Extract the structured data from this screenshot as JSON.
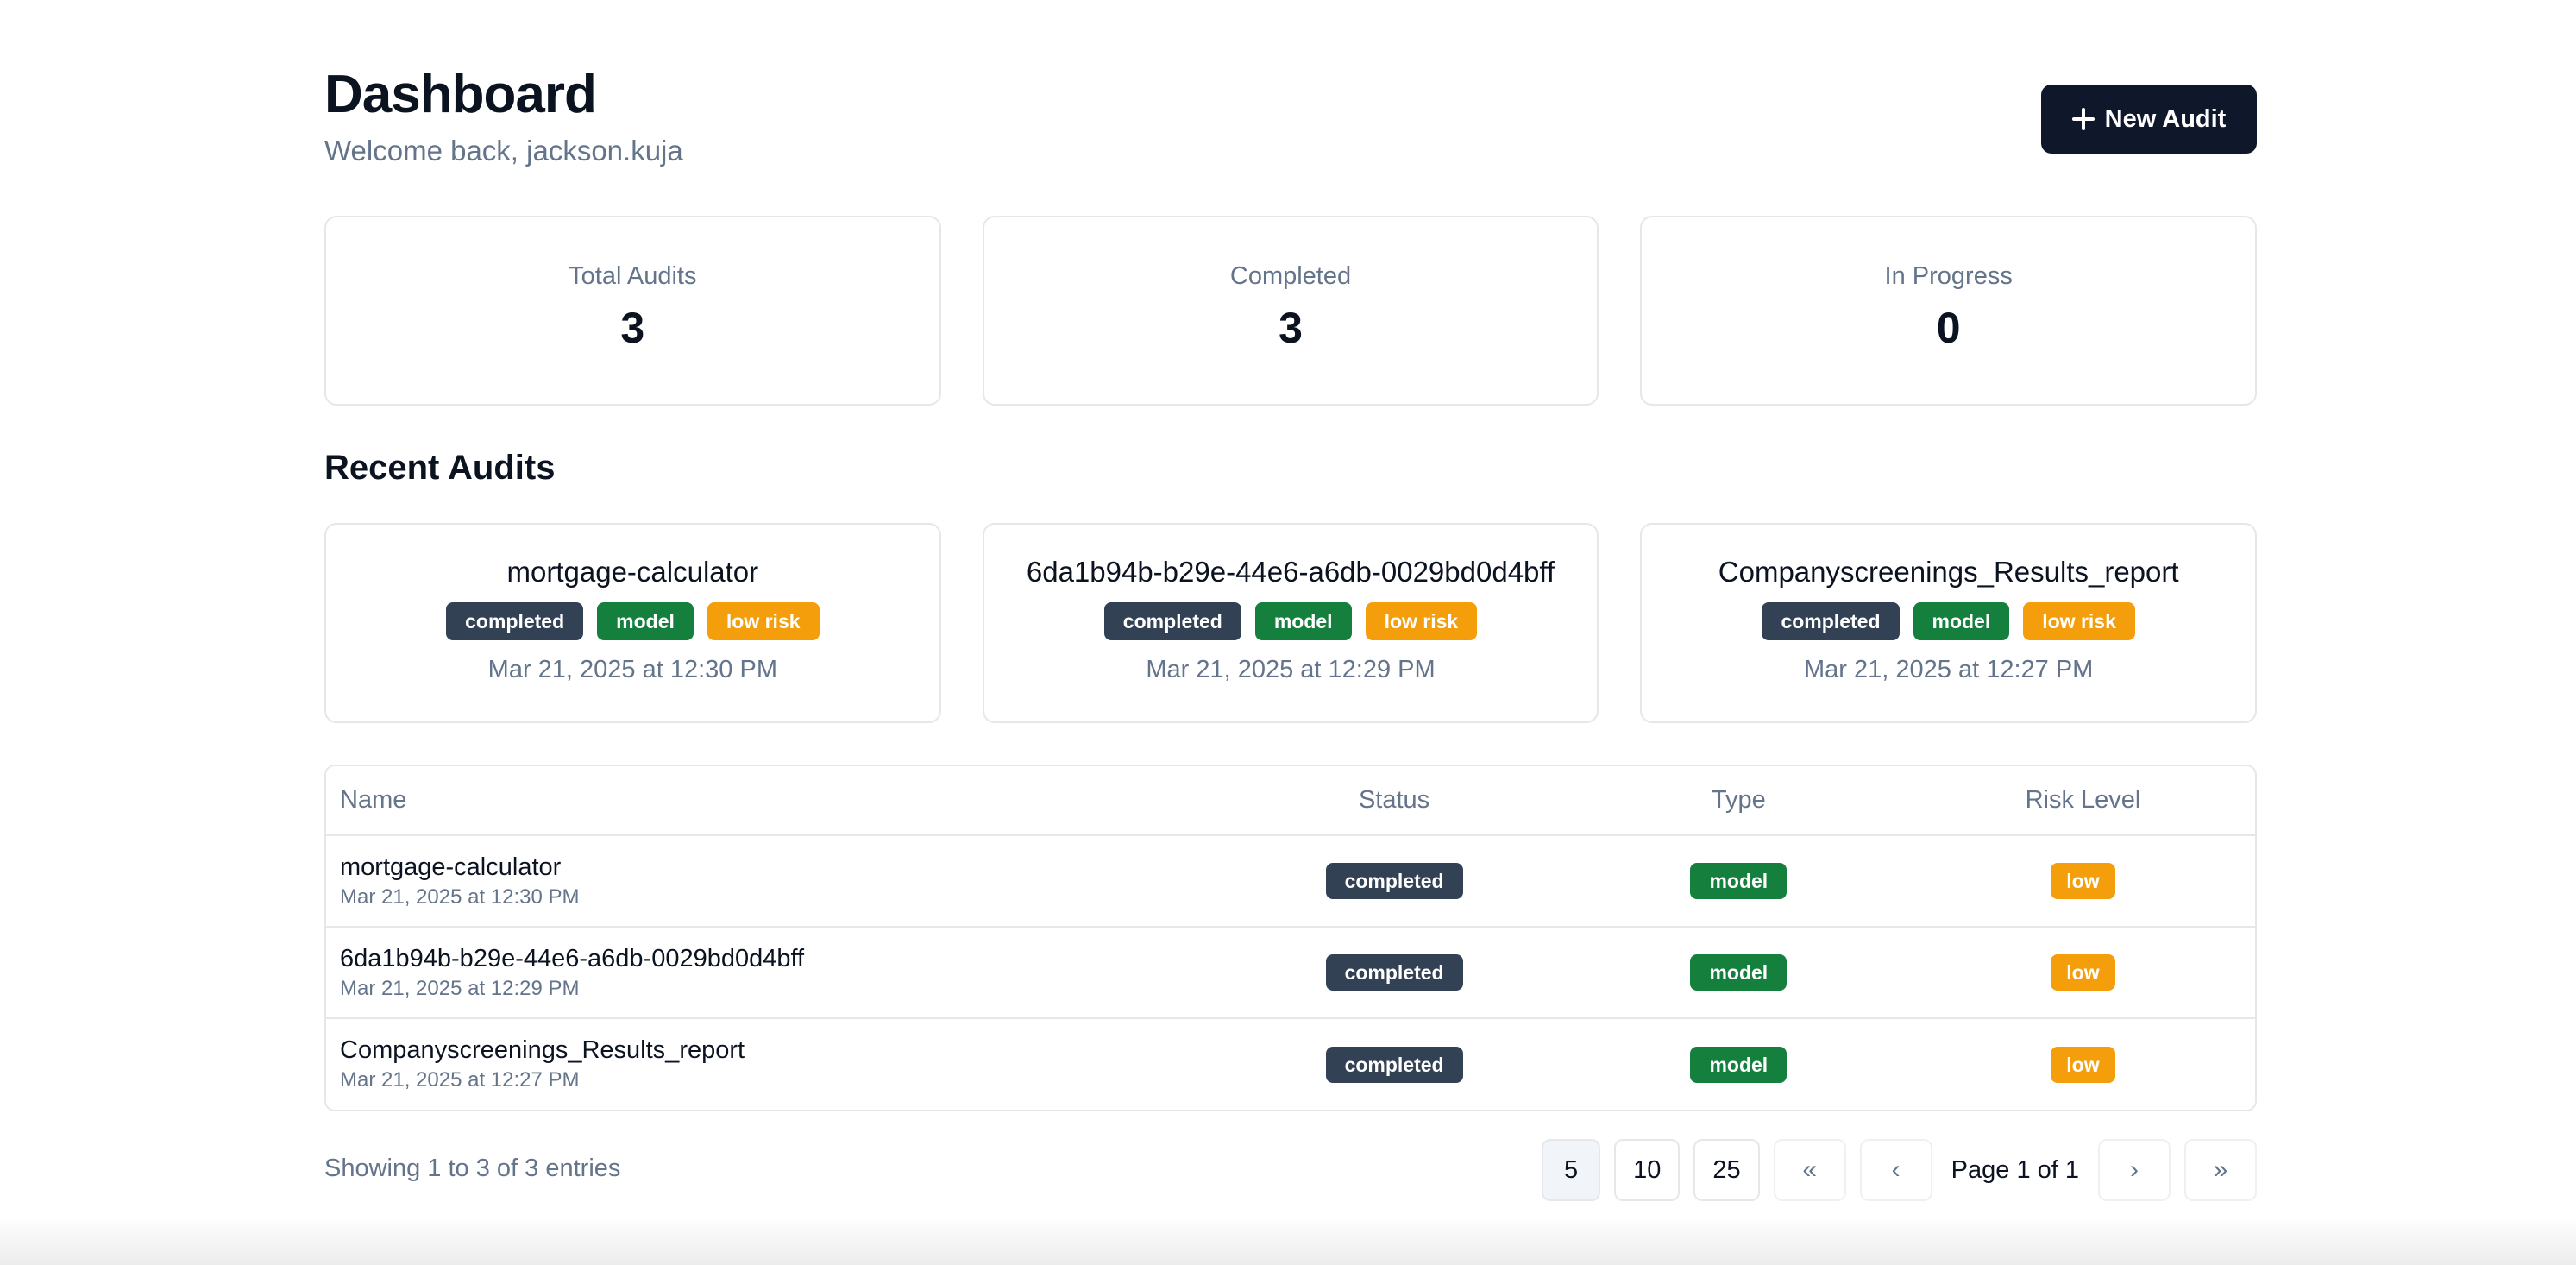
{
  "header": {
    "title": "Dashboard",
    "subtitle": "Welcome back, jackson.kuja",
    "new_audit_label": "New Audit"
  },
  "stats": [
    {
      "label": "Total Audits",
      "value": "3"
    },
    {
      "label": "Completed",
      "value": "3"
    },
    {
      "label": "In Progress",
      "value": "0"
    }
  ],
  "recent": {
    "title": "Recent Audits",
    "cards": [
      {
        "name": "mortgage-calculator",
        "status": "completed",
        "type": "model",
        "risk": "low risk",
        "date": "Mar 21, 2025 at 12:30 PM"
      },
      {
        "name": "6da1b94b-b29e-44e6-a6db-0029bd0d4bff",
        "status": "completed",
        "type": "model",
        "risk": "low risk",
        "date": "Mar 21, 2025 at 12:29 PM"
      },
      {
        "name": "Companyscreenings_Results_report",
        "status": "completed",
        "type": "model",
        "risk": "low risk",
        "date": "Mar 21, 2025 at 12:27 PM"
      }
    ]
  },
  "table": {
    "columns": {
      "name": "Name",
      "status": "Status",
      "type": "Type",
      "risk": "Risk Level"
    },
    "rows": [
      {
        "name": "mortgage-calculator",
        "date": "Mar 21, 2025 at 12:30 PM",
        "status": "completed",
        "type": "model",
        "risk": "low"
      },
      {
        "name": "6da1b94b-b29e-44e6-a6db-0029bd0d4bff",
        "date": "Mar 21, 2025 at 12:29 PM",
        "status": "completed",
        "type": "model",
        "risk": "low"
      },
      {
        "name": "Companyscreenings_Results_report",
        "date": "Mar 21, 2025 at 12:27 PM",
        "status": "completed",
        "type": "model",
        "risk": "low"
      }
    ]
  },
  "pagination": {
    "info": "Showing 1 to 3 of 3 entries",
    "sizes": [
      "5",
      "10",
      "25"
    ],
    "page_label": "Page 1 of 1",
    "first": "«",
    "prev": "‹",
    "next": "›",
    "last": "»"
  },
  "colors": {
    "primary": "#0f172a",
    "status_badge": "#334155",
    "type_badge": "#15803d",
    "risk_badge": "#f59e0b"
  },
  "icons": {
    "new_audit": "plus-icon",
    "first": "chevrons-left-icon",
    "prev": "chevron-left-icon",
    "next": "chevron-right-icon",
    "last": "chevrons-right-icon"
  }
}
